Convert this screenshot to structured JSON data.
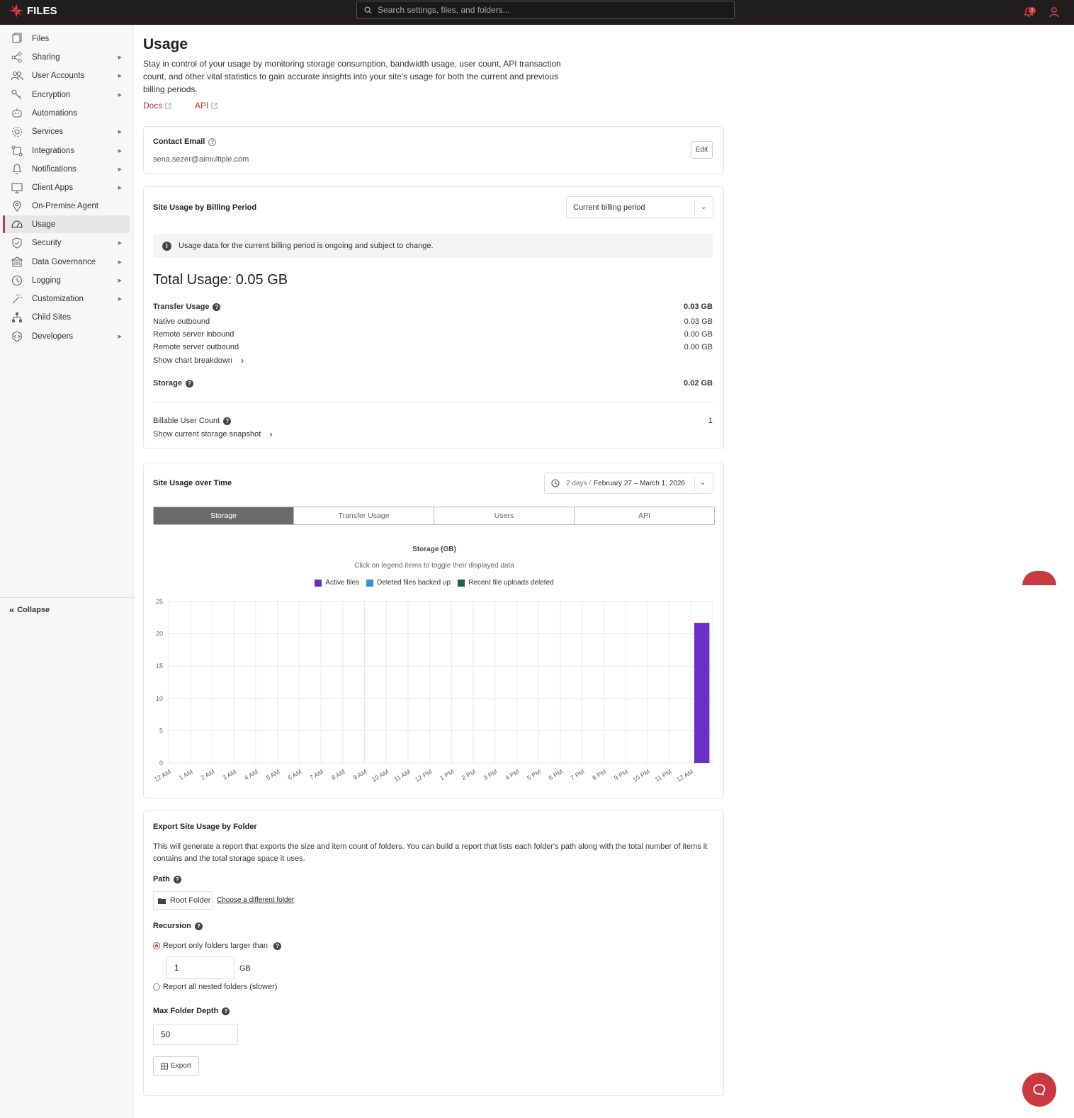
{
  "app": {
    "logo_text": "FILES",
    "search_placeholder": "Search settings, files, and folders...",
    "notification_count": "1"
  },
  "sidebar": {
    "items": [
      {
        "label": "Files",
        "icon": "files-icon",
        "arrow": false
      },
      {
        "label": "Sharing",
        "icon": "share-icon",
        "arrow": true
      },
      {
        "label": "User Accounts",
        "icon": "users-icon",
        "arrow": true
      },
      {
        "label": "Encryption",
        "icon": "key-icon",
        "arrow": true
      },
      {
        "label": "Automations",
        "icon": "robot-icon",
        "arrow": false
      },
      {
        "label": "Services",
        "icon": "gear-icon",
        "arrow": true
      },
      {
        "label": "Integrations",
        "icon": "integrations-icon",
        "arrow": true
      },
      {
        "label": "Notifications",
        "icon": "bell-icon",
        "arrow": true
      },
      {
        "label": "Client Apps",
        "icon": "monitor-icon",
        "arrow": true
      },
      {
        "label": "On-Premise Agent",
        "icon": "location-pin-icon",
        "arrow": false
      },
      {
        "label": "Usage",
        "icon": "gauge-icon",
        "arrow": false,
        "active": true
      },
      {
        "label": "Security",
        "icon": "shield-icon",
        "arrow": true
      },
      {
        "label": "Data Governance",
        "icon": "building-icon",
        "arrow": true
      },
      {
        "label": "Logging",
        "icon": "clock-icon",
        "arrow": true
      },
      {
        "label": "Customization",
        "icon": "wand-icon",
        "arrow": true
      },
      {
        "label": "Child Sites",
        "icon": "sitemap-icon",
        "arrow": false
      },
      {
        "label": "Developers",
        "icon": "code-icon",
        "arrow": true
      }
    ],
    "collapse_label": "Collapse"
  },
  "page": {
    "title": "Usage",
    "description": "Stay in control of your usage by monitoring storage consumption, bandwidth usage, user count, API transaction count, and other vital statistics to gain accurate insights into your site's usage for both the current and previous billing periods.",
    "docs_link": "Docs",
    "api_link": "API"
  },
  "contact": {
    "title": "Contact Email",
    "email": "sena.sezer@aimultiple.com",
    "edit_label": "Edit"
  },
  "billing": {
    "title": "Site Usage by Billing Period",
    "period_select": "Current billing period",
    "notice": "Usage data for the current billing period is ongoing and subject to change.",
    "total_usage": "Total Usage: 0.05 GB",
    "transfer_label": "Transfer Usage",
    "transfer_value": "0.03 GB",
    "native_outbound_label": "Native outbound",
    "native_outbound_value": "0.03 GB",
    "remote_inbound_label": "Remote server inbound",
    "remote_inbound_value": "0.00 GB",
    "remote_outbound_label": "Remote server outbound",
    "remote_outbound_value": "0.00 GB",
    "chart_breakdown_link": "Show chart breakdown",
    "storage_label": "Storage",
    "storage_value": "0.02 GB",
    "user_count_label": "Billable User Count",
    "user_count_value": "1",
    "snapshot_link": "Show current storage snapshot"
  },
  "over_time": {
    "title": "Site Usage over Time",
    "range_days": "2 days /",
    "range_dates": "February 27 – March 1, 2026",
    "tabs": [
      "Storage",
      "Transfer Usage",
      "Users",
      "API"
    ],
    "active_tab": "Storage",
    "chart_title": "Storage (GB)",
    "chart_hint": "Click on legend items to toggle their displayed data"
  },
  "chart_data": {
    "type": "bar",
    "title": "Storage (GB)",
    "xlabel": "",
    "ylabel": "",
    "ylim": [
      0,
      25
    ],
    "yticks": [
      0,
      5,
      10,
      15,
      20,
      25
    ],
    "grid": true,
    "legend_position": "top-center",
    "categories": [
      "12 AM",
      "1 AM",
      "2 AM",
      "3 AM",
      "4 AM",
      "5 AM",
      "6 AM",
      "7 AM",
      "8 AM",
      "9 AM",
      "10 AM",
      "11 AM",
      "12 PM",
      "1 PM",
      "2 PM",
      "3 PM",
      "4 PM",
      "5 PM",
      "6 PM",
      "7 PM",
      "8 PM",
      "9 PM",
      "10 PM",
      "11 PM",
      "12 AM"
    ],
    "series": [
      {
        "name": "Active files",
        "color": "#6a2fc7",
        "values": [
          0,
          0,
          0,
          0,
          0,
          0,
          0,
          0,
          0,
          0,
          0,
          0,
          0,
          0,
          0,
          0,
          0,
          0,
          0,
          0,
          0,
          0,
          0,
          0,
          21.7
        ]
      },
      {
        "name": "Deleted files backed up",
        "color": "#3a8fd8",
        "values": [
          0,
          0,
          0,
          0,
          0,
          0,
          0,
          0,
          0,
          0,
          0,
          0,
          0,
          0,
          0,
          0,
          0,
          0,
          0,
          0,
          0,
          0,
          0,
          0,
          0
        ]
      },
      {
        "name": "Recent file uploads deleted",
        "color": "#1f5d5a",
        "values": [
          0,
          0,
          0,
          0,
          0,
          0,
          0,
          0,
          0,
          0,
          0,
          0,
          0,
          0,
          0,
          0,
          0,
          0,
          0,
          0,
          0,
          0,
          0,
          0,
          0
        ]
      }
    ]
  },
  "export": {
    "title": "Export Site Usage by Folder",
    "description": "This will generate a report that exports the size and item count of folders. You can build a report that lists each folder's path along with the total number of items it contains and the total storage space it uses.",
    "path_label": "Path",
    "root_folder": "Root Folder",
    "choose_folder": "Choose a different folder",
    "recursion_label": "Recursion",
    "option_larger": "Report only folders larger than",
    "size_value": "1",
    "size_unit": "GB",
    "option_nested": "Report all nested folders (slower)",
    "depth_label": "Max Folder Depth",
    "depth_value": "50",
    "export_label": "Export"
  }
}
